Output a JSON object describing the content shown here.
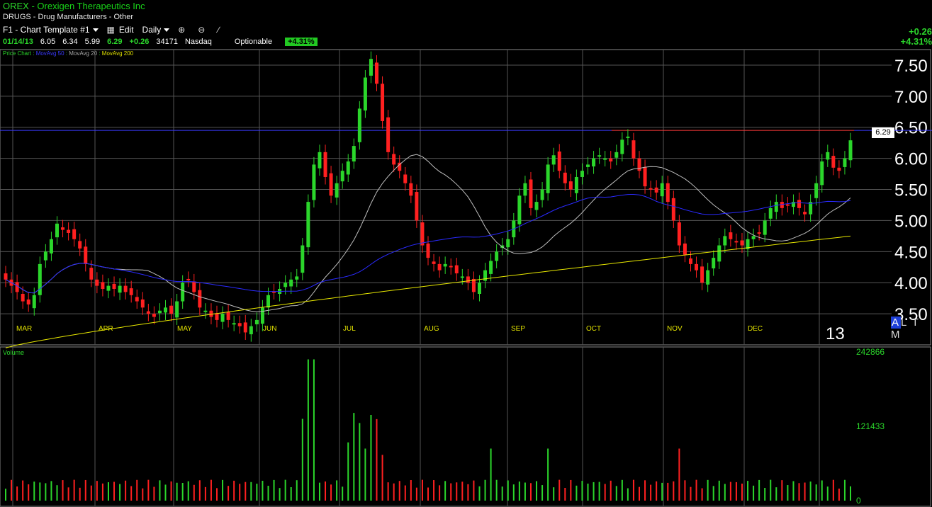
{
  "header": {
    "symbol": "OREX",
    "company": "Orexigen Therapeutics Inc",
    "sector": "DRUGS - Drug Manufacturers - Other",
    "template": "F1 - Chart Template #1",
    "edit_label": "Edit",
    "period": "Daily",
    "quote": {
      "date": "01/14/13",
      "open": "6.05",
      "high": "6.34",
      "low": "5.99",
      "close": "6.29",
      "change": "+0.26",
      "volume": "34171",
      "exchange": "Nasdaq",
      "optionable": "Optionable",
      "pct": "+4.31%"
    },
    "right_change": "+0.26",
    "right_pct": "+4.31%"
  },
  "legend": {
    "price": "Price Chart",
    "ma50": "MovAvg 50",
    "ma20": "MovAvg 20",
    "ma200": "MovAvg 200"
  },
  "last_price_tag": "6.29",
  "year_label": "13",
  "timeframes": [
    "A",
    "L",
    "T",
    "M"
  ],
  "volume_label": "Volume",
  "colors": {
    "up": "#2bd62b",
    "down": "#ff2020",
    "ma50": "#2a2aff",
    "ma20": "#bdbdbd",
    "ma200": "#e8e800",
    "hline_blue": "#3b3bff",
    "hline_red": "#ff3b3b"
  },
  "chart_data": [
    {
      "type": "candlestick",
      "title": "OREX - Orexigen Therapeutics Inc",
      "x_months": [
        "MAR",
        "APR",
        "MAY",
        "JUN",
        "JUL",
        "AUG",
        "SEP",
        "OCT",
        "NOV",
        "DEC"
      ],
      "y_ticks": [
        "7.50",
        "7.00",
        "6.50",
        "6.00",
        "5.50",
        "5.00",
        "4.50",
        "4.00",
        "3.50"
      ],
      "ylim": [
        3.0,
        7.75
      ],
      "close_series": [
        4.05,
        3.95,
        3.85,
        3.7,
        3.65,
        3.8,
        4.3,
        4.5,
        4.7,
        4.95,
        4.85,
        4.8,
        4.7,
        4.55,
        4.3,
        4.05,
        3.95,
        3.9,
        3.95,
        3.9,
        3.95,
        3.85,
        3.8,
        3.7,
        3.6,
        3.5,
        3.45,
        3.55,
        3.6,
        3.5,
        3.7,
        4.0,
        4.05,
        3.85,
        3.6,
        3.55,
        3.45,
        3.4,
        3.5,
        3.4,
        3.35,
        3.3,
        3.2,
        3.3,
        3.4,
        3.6,
        3.8,
        3.85,
        3.9,
        4.0,
        4.05,
        4.1,
        4.6,
        5.3,
        5.9,
        6.1,
        5.7,
        5.4,
        5.6,
        5.8,
        5.95,
        6.2,
        6.8,
        7.3,
        7.6,
        7.2,
        6.6,
        6.1,
        5.9,
        5.8,
        5.6,
        5.4,
        5.0,
        4.6,
        4.4,
        4.3,
        4.2,
        4.3,
        4.25,
        4.15,
        4.1,
        4.0,
        3.85,
        4.0,
        4.2,
        4.35,
        4.5,
        4.6,
        4.7,
        5.0,
        5.4,
        5.6,
        5.2,
        5.3,
        5.5,
        5.9,
        6.05,
        5.8,
        5.6,
        5.5,
        5.7,
        5.8,
        5.9,
        6.0,
        6.05,
        6.0,
        5.95,
        6.1,
        6.3,
        6.35,
        6.0,
        5.8,
        5.55,
        5.5,
        5.45,
        5.6,
        5.3,
        5.0,
        4.6,
        4.45,
        4.3,
        4.2,
        4.0,
        4.2,
        4.4,
        4.6,
        4.75,
        4.7,
        4.65,
        4.6,
        4.7,
        4.75,
        4.8,
        5.0,
        5.2,
        5.3,
        5.2,
        5.25,
        5.3,
        5.2,
        5.1,
        5.3,
        5.6,
        5.95,
        6.1,
        5.85,
        5.8,
        6.0,
        6.29
      ],
      "moving_averages": [
        "MovAvg 50",
        "MovAvg 20",
        "MovAvg 200"
      ],
      "horizontal_line": 6.45,
      "last": 6.29
    },
    {
      "type": "bar",
      "title": "Volume",
      "y_ticks": [
        "242866",
        "121433",
        "0"
      ],
      "ylim": [
        0,
        242866
      ]
    }
  ]
}
